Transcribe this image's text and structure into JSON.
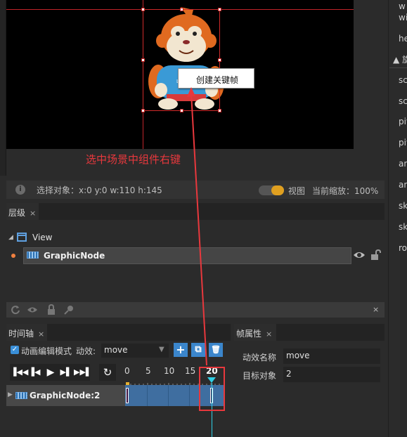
{
  "context_menu": {
    "create_keyframe": "创建关键帧"
  },
  "annotation": {
    "text": "选中场景中组件右键"
  },
  "status_bar": {
    "info_icon": "i",
    "selection_info": "选择对象：x:0 y:0  w:110 h:145",
    "view_label": "视图",
    "zoom_label": "当前缩放：100%"
  },
  "hierarchy": {
    "tab_label": "层级",
    "close_glyph": "×",
    "root_label": "View",
    "child_label": "GraphicNode"
  },
  "search_strip": {
    "close_glyph": "×"
  },
  "timeline": {
    "tab_label": "时间轴",
    "close_glyph": "×",
    "check_glyph": "✓",
    "edit_mode_label": "动画编辑模式",
    "effect_label": "动效:",
    "effect_value": "move",
    "tool_add": "+",
    "tool_copy": "⧉",
    "tool_delete": "🗑",
    "ticks": [
      "0",
      "5",
      "10",
      "15",
      "20"
    ],
    "loop_glyph": "↻",
    "track_label": "GraphicNode:2",
    "playhead_frame": 20
  },
  "frame_props": {
    "tab_label": "帧属性",
    "close_glyph": "×",
    "effect_name_key": "动效名称",
    "effect_name_value": "move",
    "target_key": "目标对象",
    "target_value": "2"
  },
  "right_panel": {
    "items": [
      "w",
      "wi",
      "he",
      "▲ 旋",
      "sc",
      "sc",
      "piv",
      "piv",
      "an",
      "an",
      "sk",
      "sk",
      "ro"
    ]
  },
  "colors": {
    "accent_blue": "#3b86cc",
    "annotation_red": "#e8383d",
    "playhead_cyan": "#2fd0e6",
    "toggle_orange": "#e0a020"
  }
}
